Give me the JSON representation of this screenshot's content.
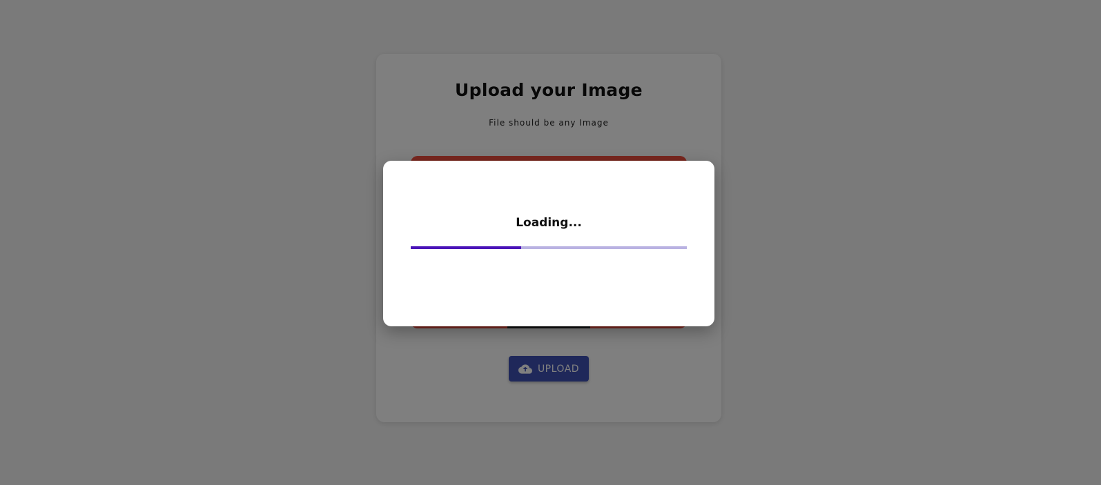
{
  "card": {
    "title": "Upload your Image",
    "subtitle": "File should be any Image",
    "upload_button": {
      "label": "UPLOAD",
      "icon": "cloud-upload-icon"
    }
  },
  "dialog": {
    "loading_text": "Loading...",
    "progress_fraction": 0.4
  },
  "colors": {
    "overlay": "rgba(0,0,0,0.5)",
    "dropzone": "#f24e3f",
    "button": "#3f51b5",
    "progress_fill": "#4a14b8",
    "progress_track": "#b9b2e2"
  }
}
